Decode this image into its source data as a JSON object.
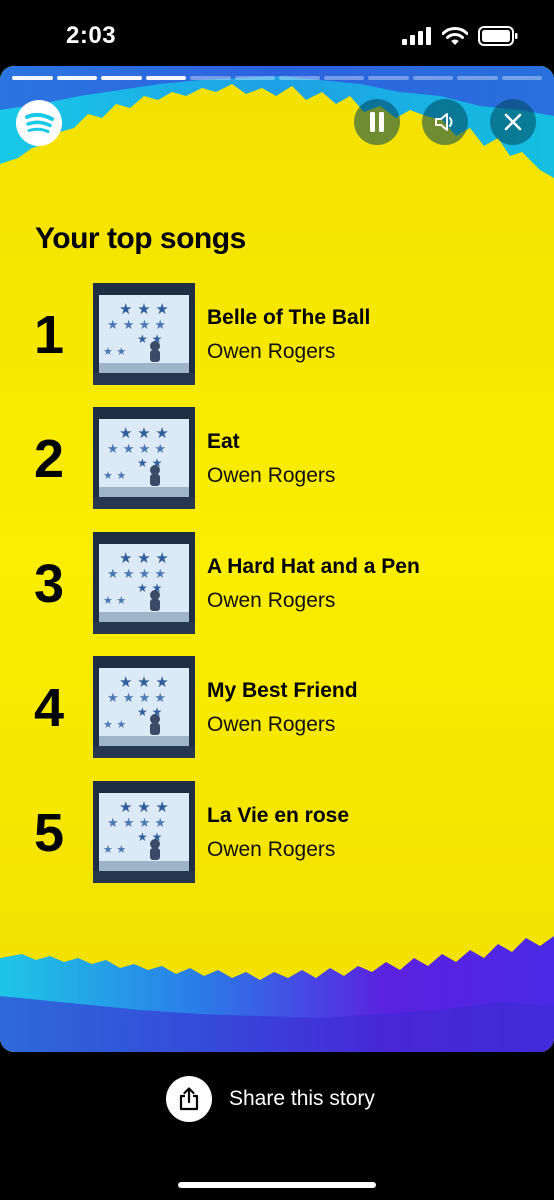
{
  "status": {
    "time": "2:03"
  },
  "story": {
    "progress": {
      "completed_segments": 4,
      "total_segments": 12
    },
    "heading": "Your top songs",
    "songs": [
      {
        "rank": "1",
        "title": "Belle of The Ball",
        "artist": "Owen Rogers"
      },
      {
        "rank": "2",
        "title": "Eat",
        "artist": "Owen Rogers"
      },
      {
        "rank": "3",
        "title": "A Hard Hat and a Pen",
        "artist": "Owen Rogers"
      },
      {
        "rank": "4",
        "title": "My Best Friend",
        "artist": "Owen Rogers"
      },
      {
        "rank": "5",
        "title": "La Vie en rose",
        "artist": "Owen Rogers"
      }
    ],
    "colors": {
      "background": "#f9ea00",
      "accent_cyan": "#14c8e6",
      "accent_purple": "#5b21e0"
    },
    "icons": [
      "spotify-logo-icon",
      "pause-icon",
      "volume-icon",
      "close-icon"
    ]
  },
  "share": {
    "label": "Share this story",
    "icon": "share-icon"
  }
}
